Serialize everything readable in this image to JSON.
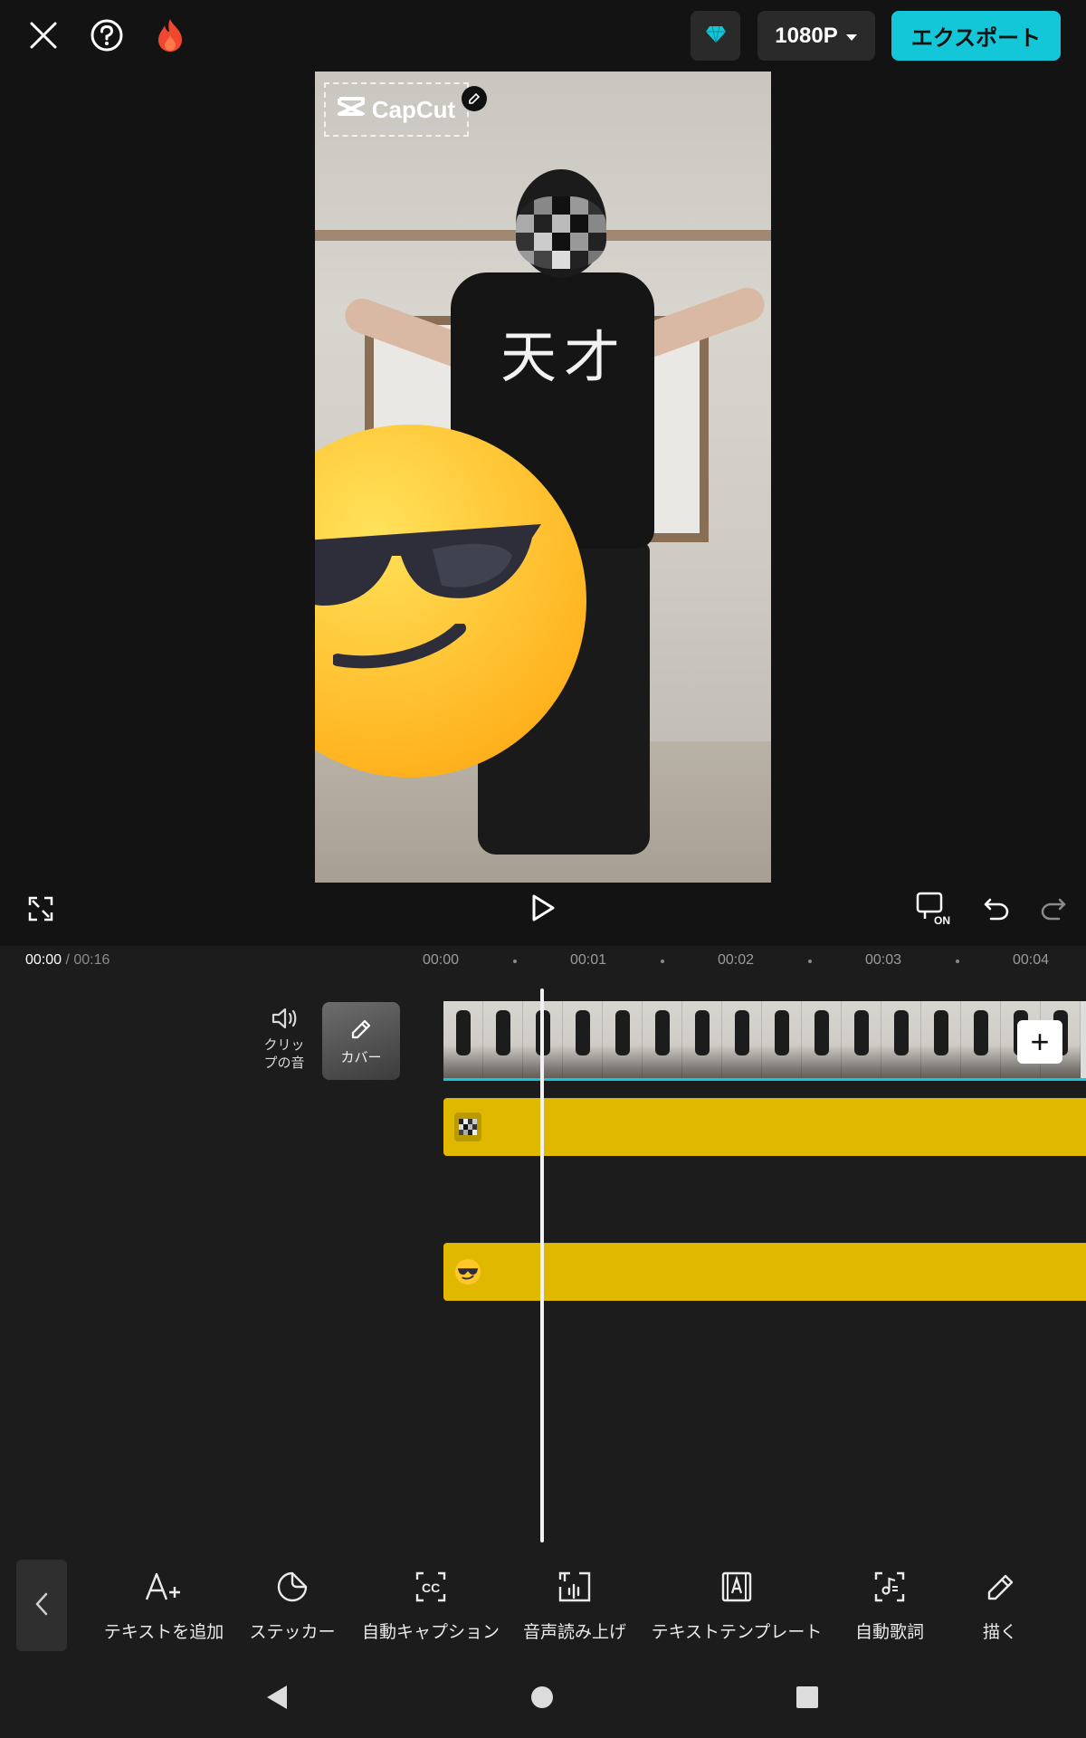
{
  "header": {
    "close_icon": "close-icon",
    "help_icon": "help-icon",
    "fire_icon": "fire-icon",
    "gem_icon": "gem-icon",
    "resolution": "1080P",
    "export_label": "エクスポート"
  },
  "preview": {
    "watermark_text": "CapCut",
    "shirt_text": "天才"
  },
  "playback": {
    "current_time": "00:00",
    "total_time": " / 00:16"
  },
  "ruler": [
    "00:00",
    "00:01",
    "00:02",
    "00:03",
    "00:04"
  ],
  "track_controls": {
    "clip_audio_label_1": "クリッ",
    "clip_audio_label_2": "プの音",
    "cover_label": "カバー",
    "add_clip": "+"
  },
  "toolbar": {
    "items": [
      {
        "label": "テキストを追加",
        "icon": "add-text-icon"
      },
      {
        "label": "ステッカー",
        "icon": "sticker-icon"
      },
      {
        "label": "自動キャプション",
        "icon": "auto-caption-icon"
      },
      {
        "label": "音声読み上げ",
        "icon": "text-to-speech-icon"
      },
      {
        "label": "テキストテンプレート",
        "icon": "text-template-icon"
      },
      {
        "label": "自動歌詞",
        "icon": "auto-lyrics-icon"
      },
      {
        "label": "描く",
        "icon": "draw-icon"
      }
    ]
  },
  "colors": {
    "accent": "#13c7d9",
    "track_yellow": "#e0b800",
    "background": "#131313"
  }
}
